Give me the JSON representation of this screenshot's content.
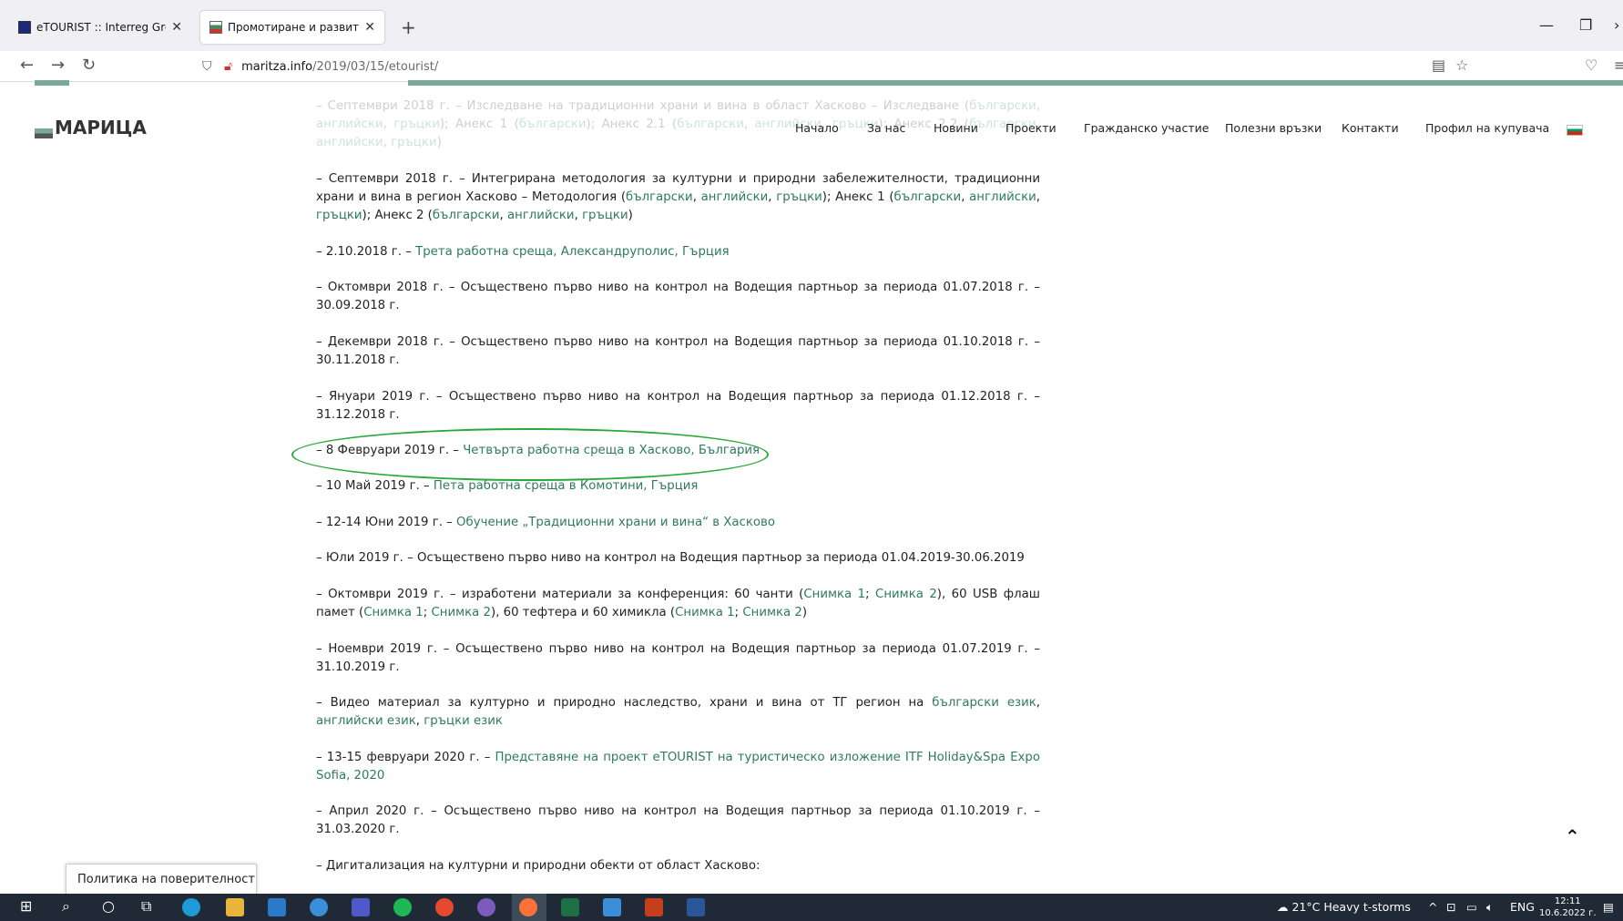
{
  "browser": {
    "tabs": [
      {
        "title": "eTOURIST :: Interreg Greece-Bul",
        "active": false
      },
      {
        "title": "Промотиране и развитие на п",
        "active": true
      }
    ],
    "url_host": "maritza.info",
    "url_path": "/2019/03/15/etourist/"
  },
  "site": {
    "logo_text": "МАРИЦА",
    "menu": [
      "Начало",
      "За нас",
      "Новини",
      "Проекти",
      "Гражданско участие",
      "Полезни връзки",
      "Контакти",
      "Профил на купувача"
    ]
  },
  "content": {
    "p0": {
      "a": "– Септември 2018 г. – Изследване на традиционни храни и вина в област Хасково – Изследване (",
      "l1": "български",
      "b": ", ",
      "l2": "английски",
      "c": ", ",
      "l3": "гръцки",
      "d": "); Анекс 1 (",
      "l4": "български",
      "e": "); Анекс 2.1 (",
      "l5": "български",
      "f": ", ",
      "l6": "английски",
      "g": ", ",
      "l7": "гръцки",
      "h": "); Анекс 2.2 (",
      "l8": "български",
      "i": ", ",
      "l9": "английски",
      "j": ", ",
      "l10": "гръцки",
      "k": ")"
    },
    "p1": {
      "a": "– Септември 2018 г. – Интегрирана методология за културни и природни забележителности, традиционни храни и вина в регион Хасково – Методология (",
      "l1": "български",
      "b": ", ",
      "l2": "английски",
      "c": ", ",
      "l3": "гръцки",
      "d": "); Анекс 1 (",
      "l4": "български",
      "e": ", ",
      "l5": "английски",
      "f": ", ",
      "l6": "гръцки",
      "g": "); Анекс 2 (",
      "l7": "български",
      "h": ", ",
      "l8": "английски",
      "i": ", ",
      "l9": "гръцки",
      "j": ")"
    },
    "p2": {
      "a": "– 2.10.2018 г. – ",
      "l1": "Трета работна среща, Александруполис, Гърция"
    },
    "p3": {
      "a": "– Октомври 2018 г. – Осъществено първо ниво на контрол на Водещия партньор за периода 01.07.2018 г. – 30.09.2018 г."
    },
    "p4": {
      "a": "– Декември 2018 г. – Осъществено първо ниво на контрол на Водещия партньор за периода 01.10.2018 г. – 30.11.2018 г."
    },
    "p5": {
      "a": "– Януари 2019 г. – Осъществено първо ниво на контрол на Водещия партньор за периода 01.12.2018 г. – 31.12.2018 г."
    },
    "p6": {
      "a": "– 8 Февруари 2019 г. – ",
      "l1": "Четвърта работна среща в Хасково, България"
    },
    "p7": {
      "a": "– 10 Май 2019 г. – ",
      "l1": "Пета работна среща в Комотини, Гърция"
    },
    "p8": {
      "a": "– 12-14 Юни 2019 г. – ",
      "l1": "Обучение „Традиционни храни и вина“ в Хасково"
    },
    "p9": {
      "a": "– Юли 2019 г. – Осъществено първо ниво на контрол на Водещия партньор за периода 01.04.2019-30.06.2019"
    },
    "p10": {
      "a": "– Октомври 2019 г. – изработени материали за конференция: 60 чанти (",
      "l1": "Снимка 1",
      "b": "; ",
      "l2": "Снимка 2",
      "c": "), 60 USB флаш памет (",
      "l3": "Снимка 1",
      "d": "; ",
      "l4": "Снимка 2",
      "e": "), 60 тефтера и 60 химикла (",
      "l5": "Снимка 1",
      "f": "; ",
      "l6": "Снимка 2",
      "g": ")"
    },
    "p11": {
      "a": "– Ноември 2019 г. – Осъществено първо ниво на контрол на Водещия партньор за периода 01.07.2019 г. – 31.10.2019 г."
    },
    "p12": {
      "a": "– Видео материал за културно и природно наследство, храни и вина от ТГ регион на ",
      "l1": "български език",
      "b": ", ",
      "l2": "английски език",
      "c": ", ",
      "l3": "гръцки език"
    },
    "p13": {
      "a": "– 13-15 февруари 2020 г. – ",
      "l1": "Представяне на проект eTOURIST на туристическо изложение ITF Holiday&Spa Expo Sofia, 2020"
    },
    "p14": {
      "a": "– Април 2020 г. – Осъществено първо ниво на контрол на Водещия партньор за периода 01.10.2019 г. – 31.03.2020 г."
    },
    "p15": {
      "a": "– Дигитализация на културни и природни обекти от област Хасково:"
    }
  },
  "privacy_label": "Политика на поверителност",
  "taskbar": {
    "weather": "21°C  Heavy t-storms",
    "lang": "ENG",
    "time": "12:11",
    "date": "10.6.2022 г."
  }
}
